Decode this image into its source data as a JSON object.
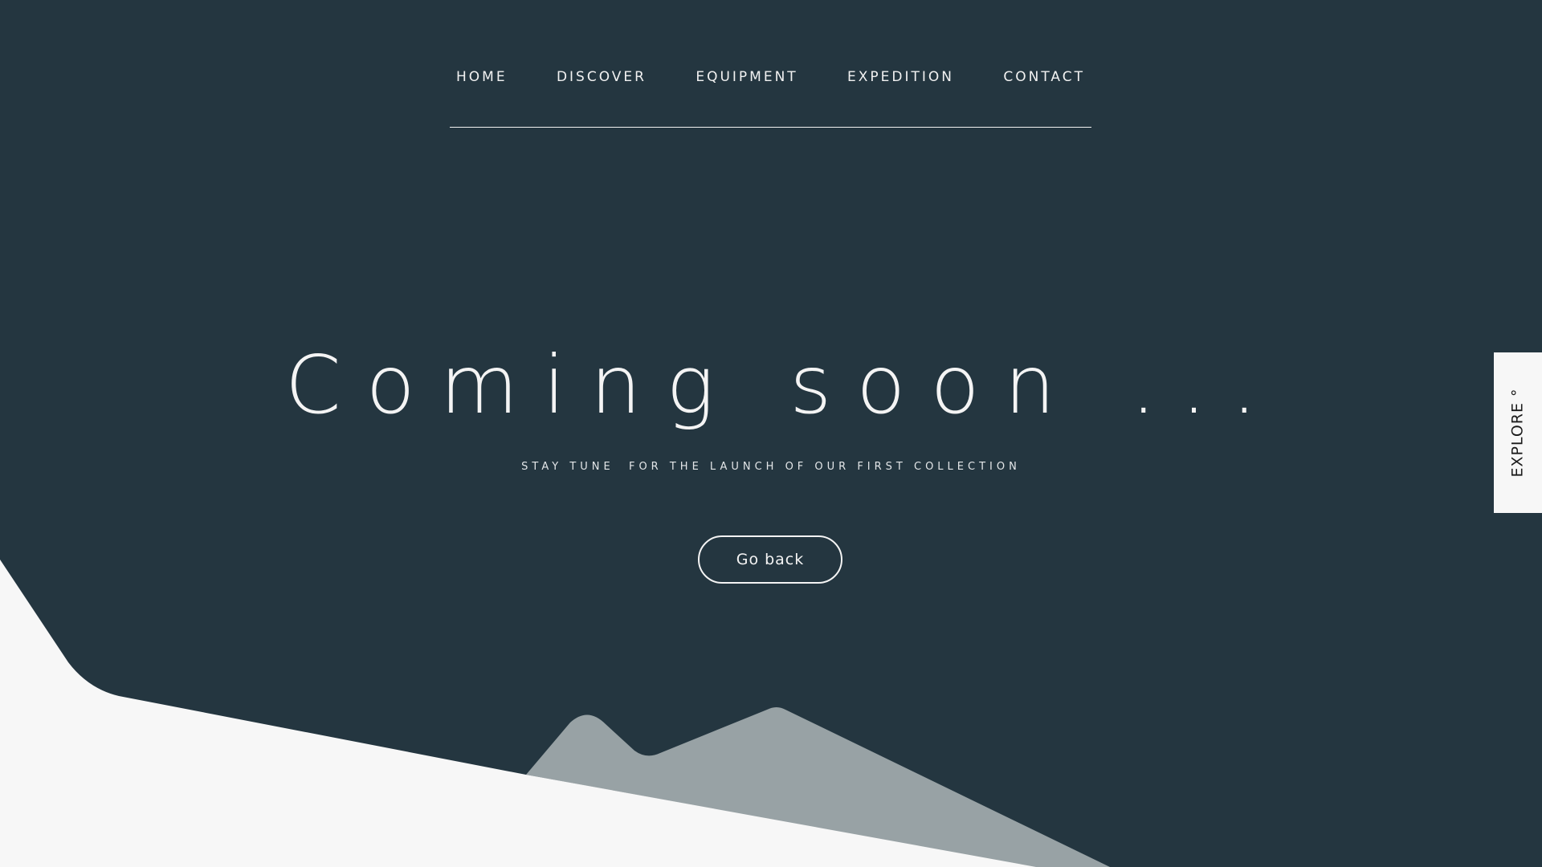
{
  "nav": {
    "items": [
      {
        "label": "HOME"
      },
      {
        "label": "DISCOVER"
      },
      {
        "label": "EQUIPMENT"
      },
      {
        "label": "EXPEDITION"
      },
      {
        "label": "CONTACT"
      }
    ]
  },
  "hero": {
    "headline": "Coming soon ...",
    "subtitle": "STAY TUNE  FOR THE LAUNCH OF OUR FIRST COLLECTION",
    "button_label": "Go back"
  },
  "side_tab": {
    "label": "EXPLORE °"
  },
  "colors": {
    "background": "#243640",
    "foreground": "#f4f4f4",
    "hill_light": "#f7f7f7",
    "hill_grey": "#98a2a5"
  }
}
